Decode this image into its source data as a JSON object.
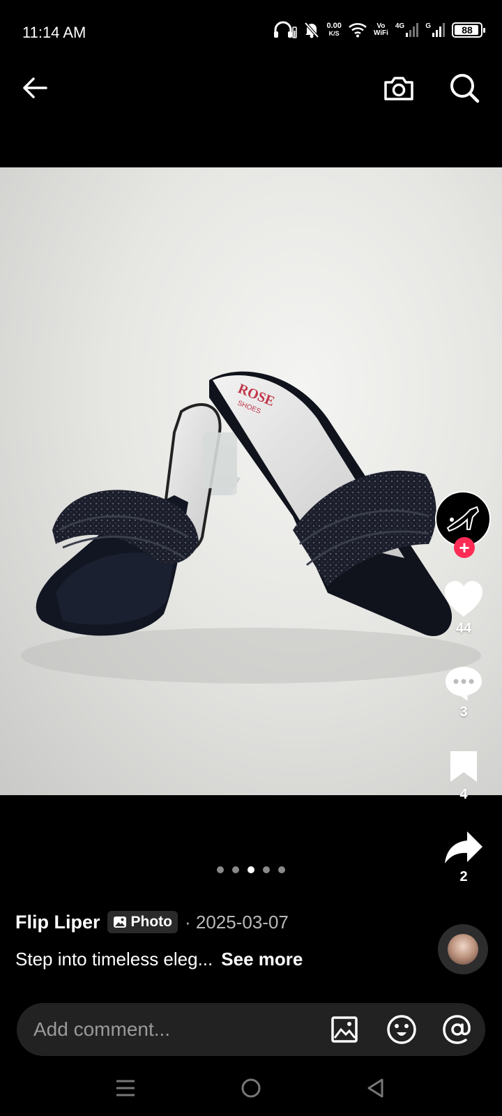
{
  "status_bar": {
    "time": "11:14 AM",
    "net_speed": "0.00",
    "net_speed_unit": "K/S",
    "volte_top": "Vo",
    "volte_bottom": "WiFi",
    "sim1_label": "4G",
    "sim2_label": "G",
    "battery": "88"
  },
  "top_nav": {
    "icons": [
      "back-arrow-icon",
      "camera-icon",
      "search-icon"
    ]
  },
  "photo": {
    "logo_text": "ROSE",
    "logo_subtext": "SHOES"
  },
  "rail": {
    "likes": "44",
    "comments": "3",
    "saves": "4",
    "shares": "2",
    "follow_plus": "+"
  },
  "carousel": {
    "count": 5,
    "active_index": 2
  },
  "post": {
    "author": "Flip Liper",
    "badge_label": "Photo",
    "date": "· 2025-03-07",
    "caption": "Step into timeless eleg...",
    "see_more": "See more"
  },
  "comment_bar": {
    "placeholder": "Add comment..."
  },
  "colors": {
    "accent": "#fe2c55",
    "background": "#000000",
    "bar": "#222222"
  }
}
